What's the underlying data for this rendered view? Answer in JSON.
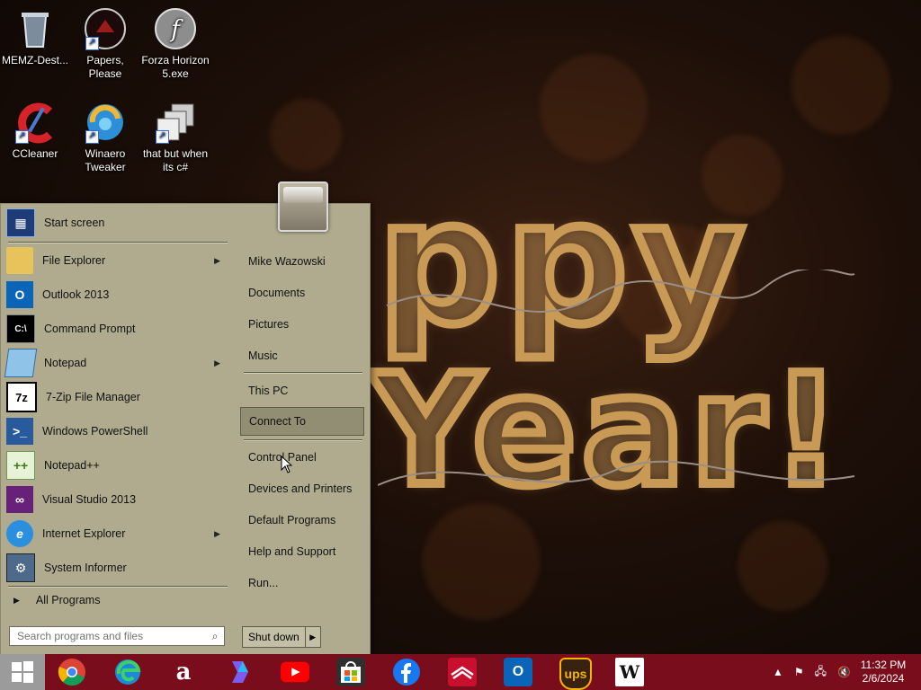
{
  "desktop": {
    "icons": [
      {
        "label": "MEMZ-Dest...",
        "icon": "recycle-bin-icon"
      },
      {
        "label": "Papers, Please",
        "icon": "papers-please-icon"
      },
      {
        "label": "Forza Horizon 5.exe",
        "icon": "flash-icon"
      },
      {
        "label": "CCleaner",
        "icon": "ccleaner-icon"
      },
      {
        "label": "Winaero Tweaker",
        "icon": "winaero-icon"
      },
      {
        "label": "that but when its c#",
        "icon": "windows-stack-icon"
      }
    ]
  },
  "start_menu": {
    "pinned": [
      {
        "label": "Start screen"
      }
    ],
    "programs": [
      {
        "label": "File Explorer",
        "has_submenu": true
      },
      {
        "label": "Outlook 2013",
        "has_submenu": false
      },
      {
        "label": "Command Prompt",
        "has_submenu": false
      },
      {
        "label": "Notepad",
        "has_submenu": true
      },
      {
        "label": "7-Zip File Manager",
        "has_submenu": false
      },
      {
        "label": "Windows PowerShell",
        "has_submenu": false
      },
      {
        "label": "Notepad++",
        "has_submenu": false
      },
      {
        "label": "Visual Studio 2013",
        "has_submenu": false
      },
      {
        "label": "Internet Explorer",
        "has_submenu": true
      },
      {
        "label": "System Informer",
        "has_submenu": false
      }
    ],
    "all_programs_label": "All Programs",
    "search_placeholder": "Search programs and files",
    "right_items": [
      {
        "label": "Mike Wazowski"
      },
      {
        "label": "Documents"
      },
      {
        "label": "Pictures"
      },
      {
        "label": "Music"
      },
      {
        "label": "This PC"
      },
      {
        "label": "Connect To"
      },
      {
        "label": "Control Panel"
      },
      {
        "label": "Devices and Printers"
      },
      {
        "label": "Default Programs"
      },
      {
        "label": "Help and Support"
      },
      {
        "label": "Run..."
      }
    ],
    "shutdown_label": "Shut down"
  },
  "taskbar": {
    "apps": [
      "chrome-icon",
      "edge-icon",
      "amazon-icon",
      "copilot-icon",
      "youtube-icon",
      "store-icon",
      "facebook-icon",
      "bank-of-america-icon",
      "outlook-icon",
      "ups-icon",
      "wikipedia-icon"
    ],
    "amazon_glyph": "a",
    "ups_glyph": "ups",
    "wikipedia_glyph": "W",
    "clock_time": "11:32 PM",
    "clock_date": "2/6/2024"
  },
  "colors": {
    "taskbar": "#7a0d1c",
    "start_menu": "#b0ab8f",
    "hover": "#928e74"
  }
}
